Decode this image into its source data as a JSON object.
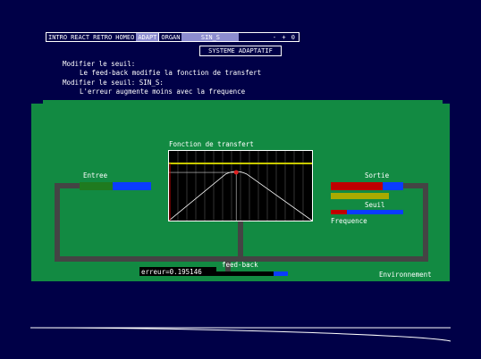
{
  "menu": {
    "items": [
      "INTRO",
      "REACT",
      "RETRO",
      "HOMEO",
      "ADAPT",
      "ORGAN"
    ],
    "active": "ADAPT",
    "mode_value": "SIN_S",
    "zoom_controls": "- + 0"
  },
  "system_title": "SYSTEME ADAPTATIF",
  "messages": [
    "Modifier le seuil:",
    "Le feed-back modifie la fonction de transfert",
    "Modifier le seuil: SIN_S:",
    "L'erreur augmente moins avec la frequence"
  ],
  "diagram": {
    "transfer_title": "Fonction de transfert",
    "input_label": "Entree",
    "output_label": "Sortie",
    "threshold_label": "Seuil",
    "frequency_label": "Frequence",
    "feedback_label": "feed-back",
    "environment_label": "Environnement",
    "error_readout": "erreur=0.195146"
  },
  "colors": {
    "background": "#000047",
    "panel": "#128a42",
    "pipe": "#444444",
    "input_green": "#1f7a1f",
    "blue": "#0a3cff",
    "red": "#c00000",
    "olive": "#aaaa00",
    "transfer_line": "#c8c800",
    "marker": "#e02020"
  },
  "levels": {
    "input_green_fraction": 0.46,
    "output_red_fraction": 0.71,
    "threshold_fraction": 0.8,
    "frequency_red_fraction": 0.22,
    "error_fraction": 0.195146,
    "transfer_peak_x": 0.47,
    "transfer_threshold_y": 0.82
  }
}
